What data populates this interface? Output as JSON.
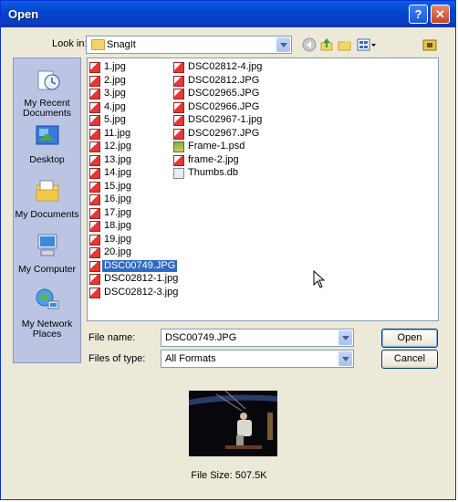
{
  "window": {
    "title": "Open",
    "help_glyph": "?",
    "close_glyph": "✕"
  },
  "lookin": {
    "label": "Look in:",
    "value": "SnagIt"
  },
  "toolbar_icons": [
    "back-icon",
    "up-folder-icon",
    "new-folder-icon",
    "views-menu-icon",
    "extra-folder-icon"
  ],
  "places": [
    {
      "label": "My Recent Documents",
      "icon": "recent-documents-icon"
    },
    {
      "label": "Desktop",
      "icon": "desktop-icon"
    },
    {
      "label": "My Documents",
      "icon": "my-documents-icon"
    },
    {
      "label": "My Computer",
      "icon": "my-computer-icon"
    },
    {
      "label": "My Network Places",
      "icon": "network-places-icon"
    }
  ],
  "files_col1": [
    "1.jpg",
    "2.jpg",
    "3.jpg",
    "4.jpg",
    "5.jpg",
    "11.jpg",
    "12.jpg",
    "13.jpg",
    "14.jpg",
    "15.jpg",
    "16.jpg",
    "17.jpg",
    "18.jpg",
    "19.jpg",
    "20.jpg",
    "DSC00749.JPG",
    "DSC02812-1.jpg",
    "DSC02812-3.jpg"
  ],
  "files_col2": [
    "DSC02812-4.jpg",
    "DSC02812.JPG",
    "DSC02965.JPG",
    "DSC02966.JPG",
    "DSC02967-1.jpg",
    "DSC02967.JPG",
    "Frame-1.psd",
    "frame-2.jpg",
    "Thumbs.db"
  ],
  "selected_file": "DSC00749.JPG",
  "filename": {
    "label": "File name:",
    "value": "DSC00749.JPG"
  },
  "filetype": {
    "label": "Files of type:",
    "value": "All Formats"
  },
  "buttons": {
    "open": "Open",
    "cancel": "Cancel"
  },
  "preview": {
    "filesize": "File Size: 507.5K"
  },
  "colors": {
    "title_bar": "#0a5fe0",
    "selection": "#316ac5",
    "dialog_bg": "#ece9d8",
    "places_bg": "#bbc5e3"
  }
}
